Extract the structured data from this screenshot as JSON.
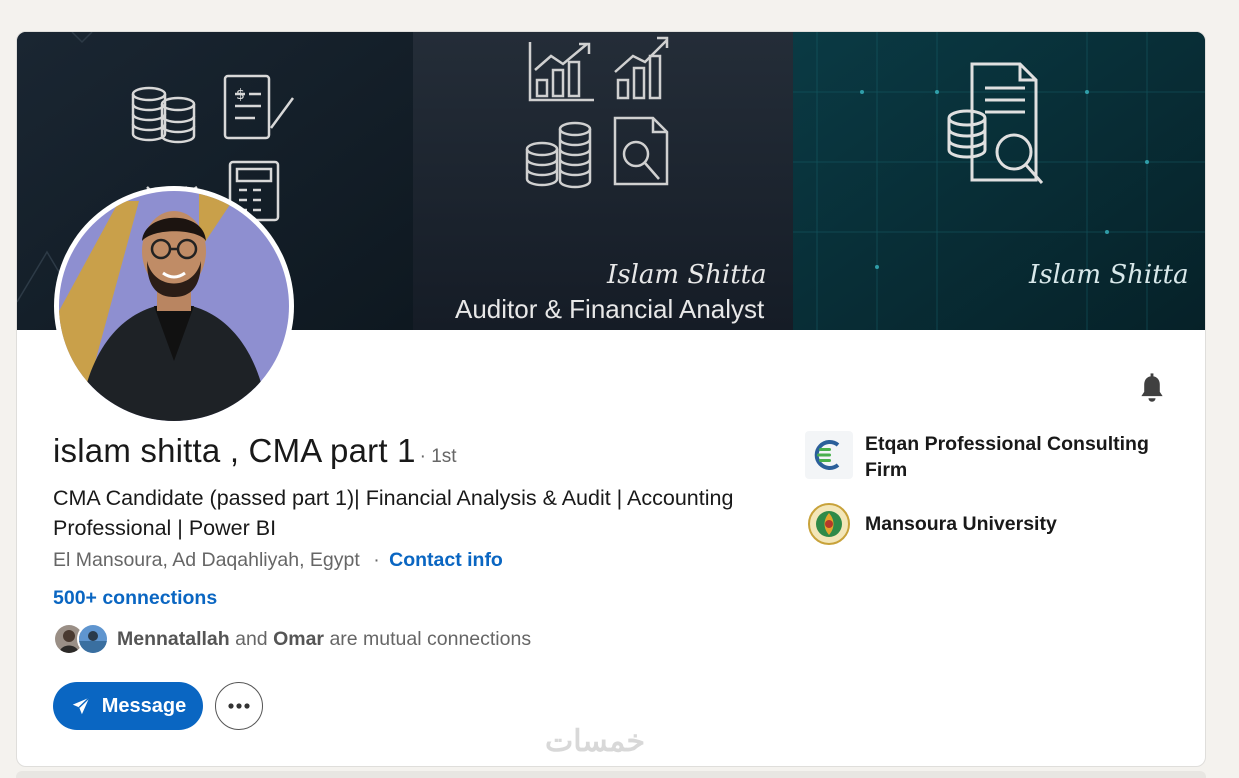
{
  "banner": {
    "signature_left": "Islam Shitta",
    "signature_right": "Islam Shitta",
    "tagline": "Auditor & Financial Analyst"
  },
  "profile": {
    "name": "islam shitta , CMA part 1",
    "degree": "· 1st",
    "headline": "CMA Candidate (passed part 1)| Financial Analysis & Audit | Accounting Professional | Power BI",
    "location": "El Mansoura, Ad Daqahliyah, Egypt",
    "location_separator": "·",
    "contact_info": "Contact info",
    "connections": "500+ connections",
    "mutual": {
      "name1": "Mennatallah",
      "and_text": "and",
      "name2": "Omar",
      "suffix": "are mutual connections"
    }
  },
  "actions": {
    "message": "Message",
    "more_icon": "ellipsis-icon",
    "bell_icon": "bell-icon"
  },
  "organizations": [
    {
      "name": "Etqan Professional Consulting Firm",
      "logo_icon": "etqan-logo"
    },
    {
      "name": "Mansoura University",
      "logo_icon": "mansoura-university-seal"
    }
  ],
  "watermark": "خمسات",
  "colors": {
    "brand_blue": "#0a66c2",
    "banner_dark": "#0d1a24",
    "text_primary": "#191919",
    "text_secondary": "#666666"
  }
}
